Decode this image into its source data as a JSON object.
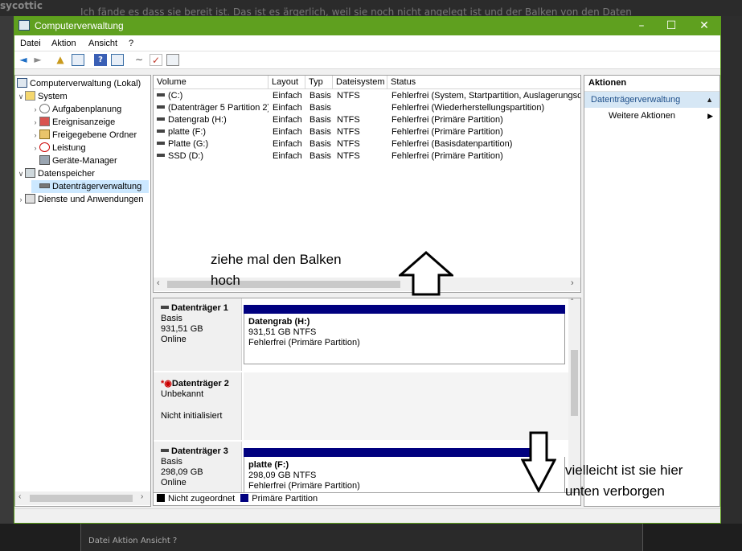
{
  "background": {
    "title_fragment": "sycottic",
    "text_fragment": "Ich fände es dass sie bereit ist. Das ist es ärgerlich, weil sie noch nicht angelegt ist und der Balken von den Daten",
    "bottom_menu": "Datei   Aktion   Ansicht   ?"
  },
  "window": {
    "title": "Computerverwaltung",
    "accent_color": "#5fa01f",
    "controls": [
      "–",
      "☐",
      "✕"
    ]
  },
  "menu": [
    "Datei",
    "Aktion",
    "Ansicht",
    "?"
  ],
  "toolbar": [
    "back-icon",
    "forward-icon",
    "up-folder-icon",
    "show-tree-icon",
    "help-icon",
    "properties-icon",
    "connect-icon",
    "check-icon",
    "console-icon"
  ],
  "tree": {
    "nodes": [
      {
        "label": "Computerverwaltung (Lokal)",
        "expander": "",
        "icon": "computer-icon"
      },
      {
        "label": "System",
        "expander": "∨",
        "icon": "tools-icon"
      },
      {
        "label": "Aufgabenplanung",
        "expander": "›",
        "icon": "clock-icon"
      },
      {
        "label": "Ereignisanzeige",
        "expander": "›",
        "icon": "event-log-icon"
      },
      {
        "label": "Freigegebene Ordner",
        "expander": "›",
        "icon": "shared-folder-icon"
      },
      {
        "label": "Leistung",
        "expander": "›",
        "icon": "performance-icon"
      },
      {
        "label": "Geräte-Manager",
        "expander": "",
        "icon": "device-manager-icon"
      },
      {
        "label": "Datenspeicher",
        "expander": "∨",
        "icon": "storage-icon"
      },
      {
        "label": "Datenträgerverwaltung",
        "expander": "",
        "icon": "disk-management-icon"
      },
      {
        "label": "Dienste und Anwendungen",
        "expander": "›",
        "icon": "services-icon"
      }
    ]
  },
  "volume_list": {
    "columns": [
      "Volume",
      "Layout",
      "Typ",
      "Dateisystem",
      "Status"
    ],
    "rows": [
      [
        "(C:)",
        "Einfach",
        "Basis",
        "NTFS",
        "Fehlerfrei (System, Startpartition, Auslagerungsdat"
      ],
      [
        "(Datenträger 5 Partition 2)",
        "Einfach",
        "Basis",
        "",
        "Fehlerfrei (Wiederherstellungspartition)"
      ],
      [
        "Datengrab (H:)",
        "Einfach",
        "Basis",
        "NTFS",
        "Fehlerfrei (Primäre Partition)"
      ],
      [
        "platte (F:)",
        "Einfach",
        "Basis",
        "NTFS",
        "Fehlerfrei (Primäre Partition)"
      ],
      [
        "Platte (G:)",
        "Einfach",
        "Basis",
        "NTFS",
        "Fehlerfrei (Basisdatenpartition)"
      ],
      [
        "SSD (D:)",
        "Einfach",
        "Basis",
        "NTFS",
        "Fehlerfrei (Primäre Partition)"
      ]
    ]
  },
  "disks": [
    {
      "name": "Datenträger 1",
      "type": "Basis",
      "size": "931,51 GB",
      "state": "Online",
      "partition": {
        "name": "Datengrab  (H:)",
        "size": "931,51 GB NTFS",
        "status": "Fehlerfrei (Primäre Partition)"
      }
    },
    {
      "name": "Datenträger 2",
      "marker": "*",
      "type": "Unbekannt",
      "state": "Nicht initialisiert"
    },
    {
      "name": "Datenträger 3",
      "type": "Basis",
      "size": "298,09 GB",
      "state": "Online",
      "partition": {
        "name": "platte  (F:)",
        "size": "298,09 GB NTFS",
        "status": "Fehlerfrei (Primäre Partition)"
      }
    }
  ],
  "legend": [
    {
      "label": "Nicht zugeordnet",
      "color": "#000000"
    },
    {
      "label": "Primäre Partition",
      "color": "#00007f"
    }
  ],
  "actions": {
    "header": "Aktionen",
    "section": "Datenträgerverwaltung",
    "item": "Weitere Aktionen"
  },
  "annotations": {
    "top": "ziehe mal den Balken\nhoch",
    "bottom": "vielleicht ist sie hier\nunten verborgen"
  }
}
